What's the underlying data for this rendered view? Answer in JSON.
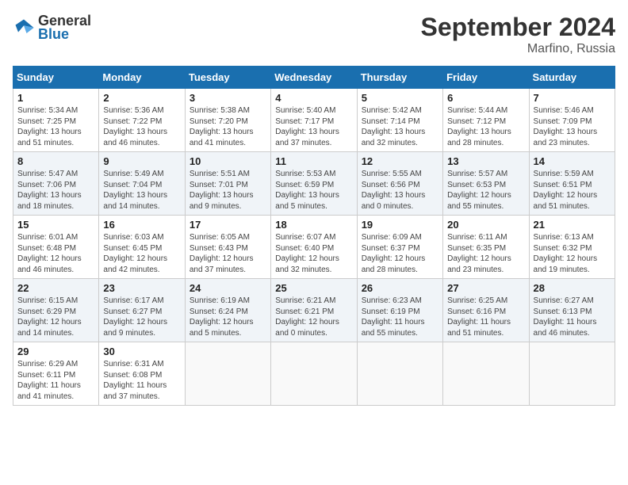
{
  "header": {
    "logo_general": "General",
    "logo_blue": "Blue",
    "month_title": "September 2024",
    "location": "Marfino, Russia"
  },
  "weekdays": [
    "Sunday",
    "Monday",
    "Tuesday",
    "Wednesday",
    "Thursday",
    "Friday",
    "Saturday"
  ],
  "weeks": [
    [
      {
        "day": "1",
        "info": "Sunrise: 5:34 AM\nSunset: 7:25 PM\nDaylight: 13 hours\nand 51 minutes."
      },
      {
        "day": "2",
        "info": "Sunrise: 5:36 AM\nSunset: 7:22 PM\nDaylight: 13 hours\nand 46 minutes."
      },
      {
        "day": "3",
        "info": "Sunrise: 5:38 AM\nSunset: 7:20 PM\nDaylight: 13 hours\nand 41 minutes."
      },
      {
        "day": "4",
        "info": "Sunrise: 5:40 AM\nSunset: 7:17 PM\nDaylight: 13 hours\nand 37 minutes."
      },
      {
        "day": "5",
        "info": "Sunrise: 5:42 AM\nSunset: 7:14 PM\nDaylight: 13 hours\nand 32 minutes."
      },
      {
        "day": "6",
        "info": "Sunrise: 5:44 AM\nSunset: 7:12 PM\nDaylight: 13 hours\nand 28 minutes."
      },
      {
        "day": "7",
        "info": "Sunrise: 5:46 AM\nSunset: 7:09 PM\nDaylight: 13 hours\nand 23 minutes."
      }
    ],
    [
      {
        "day": "8",
        "info": "Sunrise: 5:47 AM\nSunset: 7:06 PM\nDaylight: 13 hours\nand 18 minutes."
      },
      {
        "day": "9",
        "info": "Sunrise: 5:49 AM\nSunset: 7:04 PM\nDaylight: 13 hours\nand 14 minutes."
      },
      {
        "day": "10",
        "info": "Sunrise: 5:51 AM\nSunset: 7:01 PM\nDaylight: 13 hours\nand 9 minutes."
      },
      {
        "day": "11",
        "info": "Sunrise: 5:53 AM\nSunset: 6:59 PM\nDaylight: 13 hours\nand 5 minutes."
      },
      {
        "day": "12",
        "info": "Sunrise: 5:55 AM\nSunset: 6:56 PM\nDaylight: 13 hours\nand 0 minutes."
      },
      {
        "day": "13",
        "info": "Sunrise: 5:57 AM\nSunset: 6:53 PM\nDaylight: 12 hours\nand 55 minutes."
      },
      {
        "day": "14",
        "info": "Sunrise: 5:59 AM\nSunset: 6:51 PM\nDaylight: 12 hours\nand 51 minutes."
      }
    ],
    [
      {
        "day": "15",
        "info": "Sunrise: 6:01 AM\nSunset: 6:48 PM\nDaylight: 12 hours\nand 46 minutes."
      },
      {
        "day": "16",
        "info": "Sunrise: 6:03 AM\nSunset: 6:45 PM\nDaylight: 12 hours\nand 42 minutes."
      },
      {
        "day": "17",
        "info": "Sunrise: 6:05 AM\nSunset: 6:43 PM\nDaylight: 12 hours\nand 37 minutes."
      },
      {
        "day": "18",
        "info": "Sunrise: 6:07 AM\nSunset: 6:40 PM\nDaylight: 12 hours\nand 32 minutes."
      },
      {
        "day": "19",
        "info": "Sunrise: 6:09 AM\nSunset: 6:37 PM\nDaylight: 12 hours\nand 28 minutes."
      },
      {
        "day": "20",
        "info": "Sunrise: 6:11 AM\nSunset: 6:35 PM\nDaylight: 12 hours\nand 23 minutes."
      },
      {
        "day": "21",
        "info": "Sunrise: 6:13 AM\nSunset: 6:32 PM\nDaylight: 12 hours\nand 19 minutes."
      }
    ],
    [
      {
        "day": "22",
        "info": "Sunrise: 6:15 AM\nSunset: 6:29 PM\nDaylight: 12 hours\nand 14 minutes."
      },
      {
        "day": "23",
        "info": "Sunrise: 6:17 AM\nSunset: 6:27 PM\nDaylight: 12 hours\nand 9 minutes."
      },
      {
        "day": "24",
        "info": "Sunrise: 6:19 AM\nSunset: 6:24 PM\nDaylight: 12 hours\nand 5 minutes."
      },
      {
        "day": "25",
        "info": "Sunrise: 6:21 AM\nSunset: 6:21 PM\nDaylight: 12 hours\nand 0 minutes."
      },
      {
        "day": "26",
        "info": "Sunrise: 6:23 AM\nSunset: 6:19 PM\nDaylight: 11 hours\nand 55 minutes."
      },
      {
        "day": "27",
        "info": "Sunrise: 6:25 AM\nSunset: 6:16 PM\nDaylight: 11 hours\nand 51 minutes."
      },
      {
        "day": "28",
        "info": "Sunrise: 6:27 AM\nSunset: 6:13 PM\nDaylight: 11 hours\nand 46 minutes."
      }
    ],
    [
      {
        "day": "29",
        "info": "Sunrise: 6:29 AM\nSunset: 6:11 PM\nDaylight: 11 hours\nand 41 minutes."
      },
      {
        "day": "30",
        "info": "Sunrise: 6:31 AM\nSunset: 6:08 PM\nDaylight: 11 hours\nand 37 minutes."
      },
      null,
      null,
      null,
      null,
      null
    ]
  ]
}
